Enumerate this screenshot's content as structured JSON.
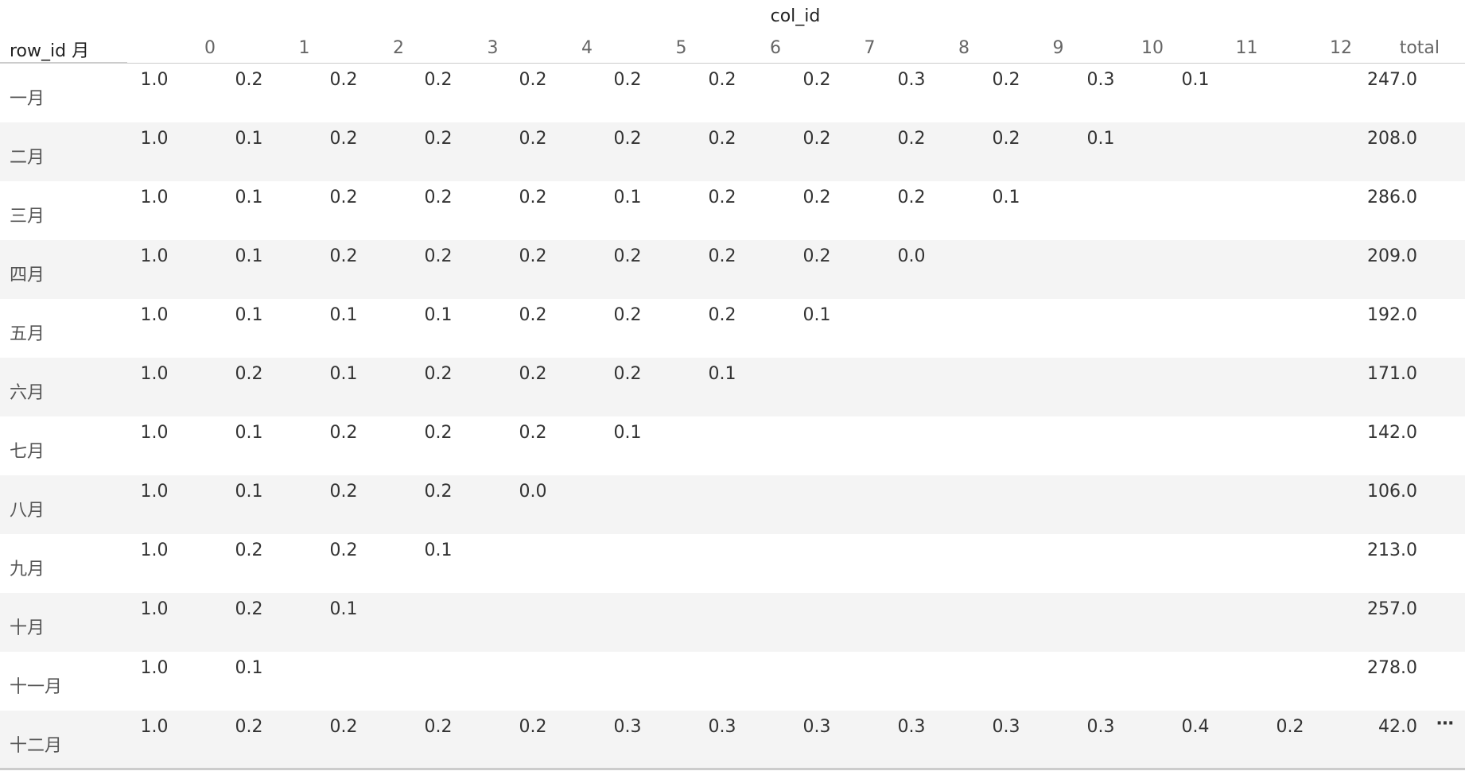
{
  "table": {
    "col_header_title": "col_id",
    "row_header_title": "row_id 月",
    "columns": [
      "0",
      "1",
      "2",
      "3",
      "4",
      "5",
      "6",
      "7",
      "8",
      "9",
      "10",
      "11",
      "12"
    ],
    "total_label": "total",
    "more_icon": "ellipsis-icon",
    "rows": [
      {
        "label": "一月",
        "values": [
          "1.0",
          "0.2",
          "0.2",
          "0.2",
          "0.2",
          "0.2",
          "0.2",
          "0.2",
          "0.3",
          "0.2",
          "0.3",
          "0.1",
          ""
        ],
        "total": "247.0"
      },
      {
        "label": "二月",
        "values": [
          "1.0",
          "0.1",
          "0.2",
          "0.2",
          "0.2",
          "0.2",
          "0.2",
          "0.2",
          "0.2",
          "0.2",
          "0.1",
          "",
          ""
        ],
        "total": "208.0"
      },
      {
        "label": "三月",
        "values": [
          "1.0",
          "0.1",
          "0.2",
          "0.2",
          "0.2",
          "0.1",
          "0.2",
          "0.2",
          "0.2",
          "0.1",
          "",
          "",
          ""
        ],
        "total": "286.0"
      },
      {
        "label": "四月",
        "values": [
          "1.0",
          "0.1",
          "0.2",
          "0.2",
          "0.2",
          "0.2",
          "0.2",
          "0.2",
          "0.0",
          "",
          "",
          "",
          ""
        ],
        "total": "209.0"
      },
      {
        "label": "五月",
        "values": [
          "1.0",
          "0.1",
          "0.1",
          "0.1",
          "0.2",
          "0.2",
          "0.2",
          "0.1",
          "",
          "",
          "",
          "",
          ""
        ],
        "total": "192.0"
      },
      {
        "label": "六月",
        "values": [
          "1.0",
          "0.2",
          "0.1",
          "0.2",
          "0.2",
          "0.2",
          "0.1",
          "",
          "",
          "",
          "",
          "",
          ""
        ],
        "total": "171.0"
      },
      {
        "label": "七月",
        "values": [
          "1.0",
          "0.1",
          "0.2",
          "0.2",
          "0.2",
          "0.1",
          "",
          "",
          "",
          "",
          "",
          "",
          ""
        ],
        "total": "142.0"
      },
      {
        "label": "八月",
        "values": [
          "1.0",
          "0.1",
          "0.2",
          "0.2",
          "0.0",
          "",
          "",
          "",
          "",
          "",
          "",
          "",
          ""
        ],
        "total": "106.0"
      },
      {
        "label": "九月",
        "values": [
          "1.0",
          "0.2",
          "0.2",
          "0.1",
          "",
          "",
          "",
          "",
          "",
          "",
          "",
          "",
          ""
        ],
        "total": "213.0"
      },
      {
        "label": "十月",
        "values": [
          "1.0",
          "0.2",
          "0.1",
          "",
          "",
          "",
          "",
          "",
          "",
          "",
          "",
          "",
          ""
        ],
        "total": "257.0"
      },
      {
        "label": "十一月",
        "values": [
          "1.0",
          "0.1",
          "",
          "",
          "",
          "",
          "",
          "",
          "",
          "",
          "",
          "",
          ""
        ],
        "total": "278.0"
      },
      {
        "label": "十二月",
        "values": [
          "1.0",
          "0.2",
          "0.2",
          "0.2",
          "0.2",
          "0.3",
          "0.3",
          "0.3",
          "0.3",
          "0.3",
          "0.3",
          "0.4",
          "0.2"
        ],
        "total": "42.0",
        "has_more": true
      }
    ]
  }
}
